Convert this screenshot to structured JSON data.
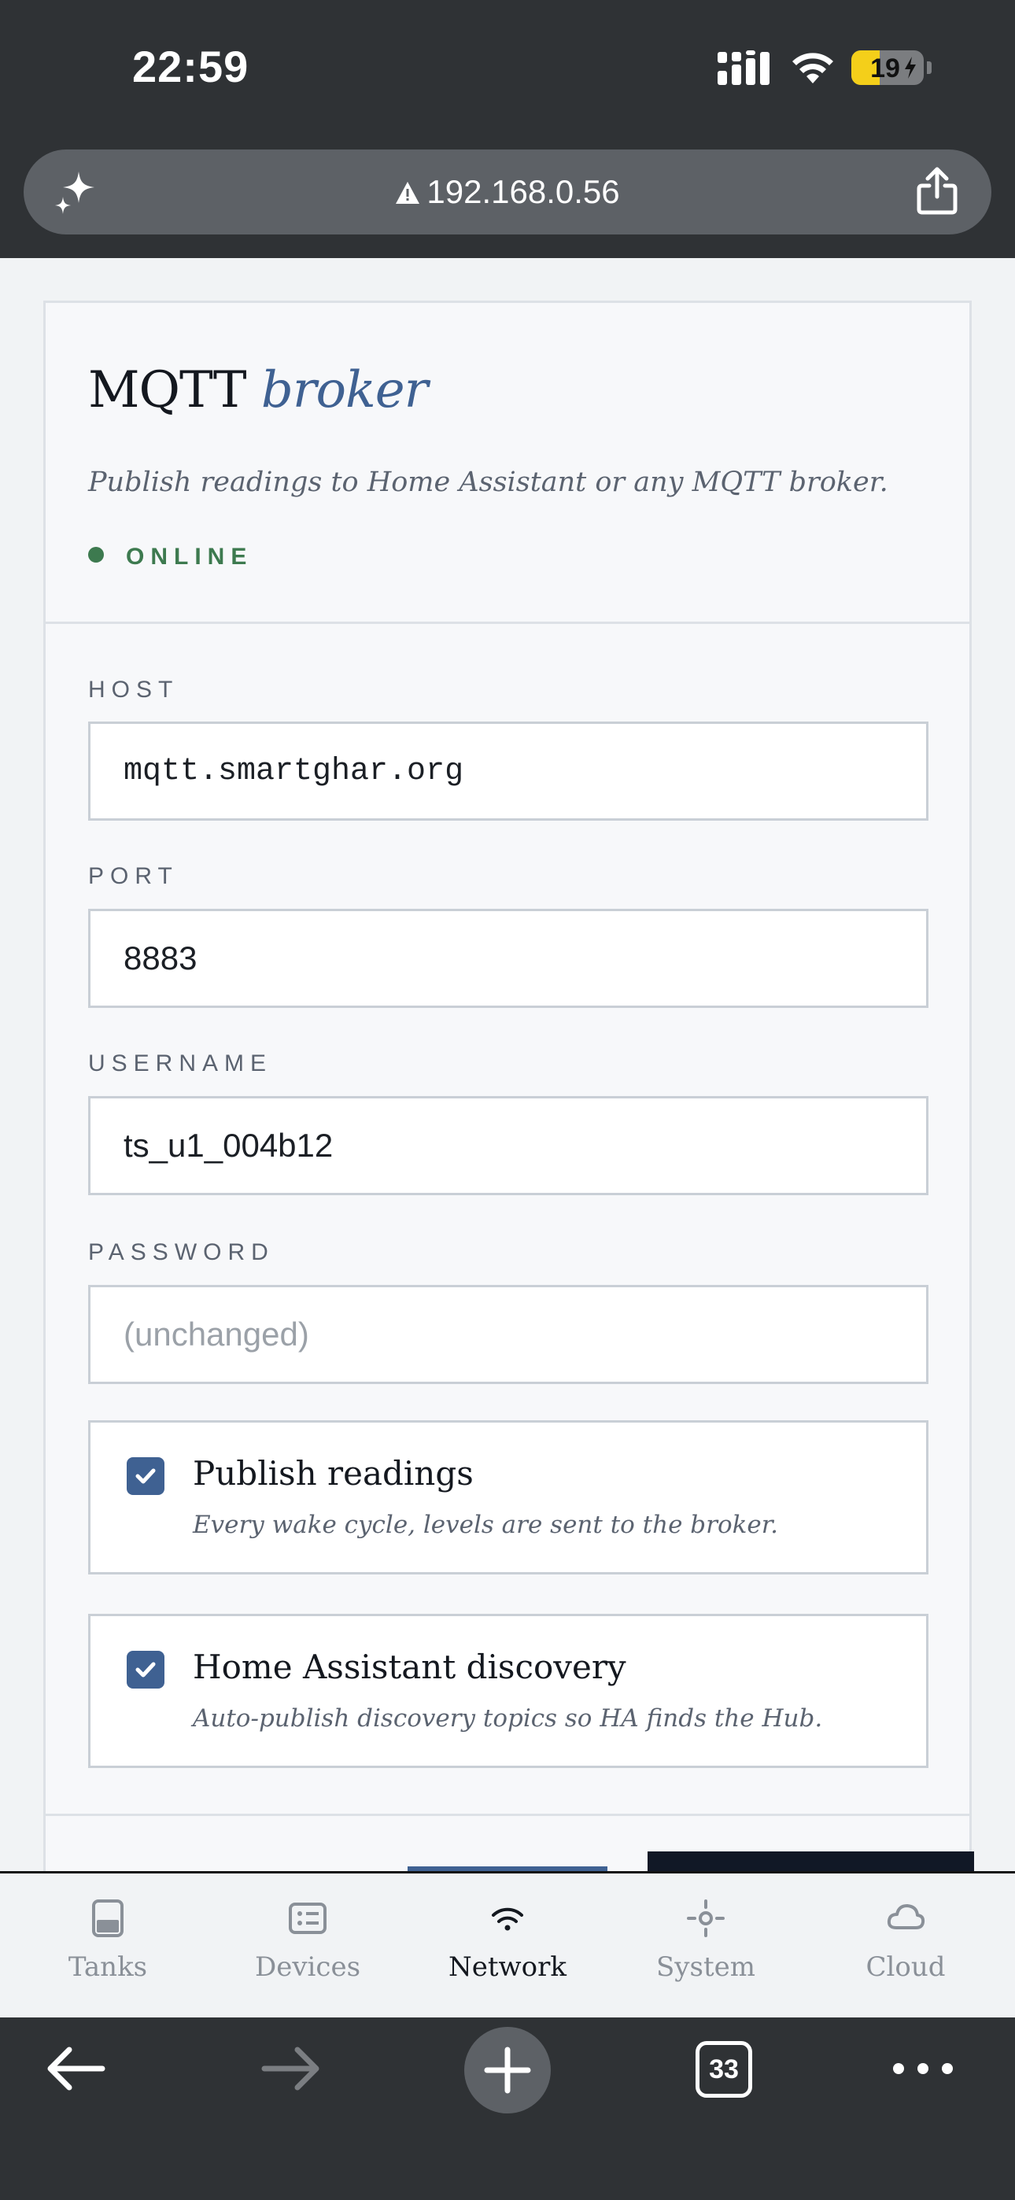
{
  "status_bar": {
    "time": "22:59",
    "battery_level": "19",
    "battery_fraction": 0.19
  },
  "browser": {
    "url": "192.168.0.56",
    "open_tabs": "33"
  },
  "card": {
    "title_main": "MQTT",
    "title_accent": "broker",
    "subtitle": "Publish readings to Home Assistant or any MQTT broker.",
    "status": "ONLINE",
    "host": {
      "label": "HOST",
      "value": "mqtt.smartghar.org"
    },
    "port": {
      "label": "PORT",
      "value": "8883"
    },
    "username": {
      "label": "USERNAME",
      "value": "ts_u1_004b12"
    },
    "password": {
      "label": "PASSWORD",
      "placeholder": "(unchanged)"
    },
    "publish": {
      "title": "Publish readings",
      "description": "Every wake cycle, levels are sent to the broker.",
      "checked": true
    },
    "discovery": {
      "title": "Home Assistant discovery",
      "description": "Auto-publish discovery topics so HA finds the Hub.",
      "checked": true
    }
  },
  "tabs": [
    {
      "label": "Tanks",
      "icon": "tank-icon"
    },
    {
      "label": "Devices",
      "icon": "devices-icon"
    },
    {
      "label": "Network",
      "icon": "wifi-icon",
      "active": true
    },
    {
      "label": "System",
      "icon": "system-icon"
    },
    {
      "label": "Cloud",
      "icon": "cloud-icon"
    }
  ],
  "colors": {
    "accent": "#3f6192",
    "online": "#3d7a4f",
    "chrome": "#2f3235"
  }
}
